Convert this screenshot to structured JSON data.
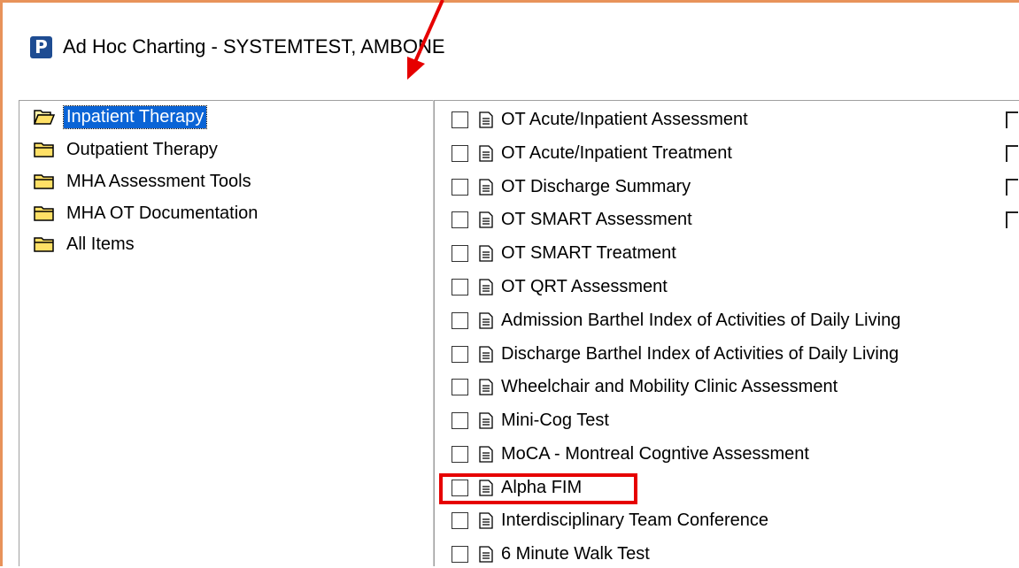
{
  "window": {
    "app_icon_letter": "P",
    "title": "Ad Hoc Charting - SYSTEMTEST, AMBONE"
  },
  "folders": [
    {
      "label": "Inpatient Therapy",
      "icon": "folder-open-icon",
      "selected": true
    },
    {
      "label": "Outpatient Therapy",
      "icon": "folder-icon",
      "selected": false
    },
    {
      "label": "MHA Assessment Tools",
      "icon": "folder-icon",
      "selected": false
    },
    {
      "label": "MHA OT Documentation",
      "icon": "folder-icon",
      "selected": false
    },
    {
      "label": "All Items",
      "icon": "folder-icon",
      "selected": false
    }
  ],
  "forms": [
    {
      "label": "OT Acute/Inpatient Assessment",
      "checked": false
    },
    {
      "label": "OT Acute/Inpatient Treatment",
      "checked": false
    },
    {
      "label": "OT Discharge Summary",
      "checked": false
    },
    {
      "label": "OT SMART Assessment",
      "checked": false
    },
    {
      "label": "OT SMART Treatment",
      "checked": false
    },
    {
      "label": "OT QRT Assessment",
      "checked": false
    },
    {
      "label": "Admission Barthel Index of Activities of Daily Living",
      "checked": false
    },
    {
      "label": "Discharge Barthel Index of Activities of Daily Living",
      "checked": false
    },
    {
      "label": "Wheelchair and Mobility Clinic Assessment",
      "checked": false
    },
    {
      "label": "Mini-Cog Test",
      "checked": false
    },
    {
      "label": "MoCA - Montreal Cogntive Assessment",
      "checked": false
    },
    {
      "label": "Alpha FIM",
      "checked": false
    },
    {
      "label": "Interdisciplinary Team Conference",
      "checked": false
    },
    {
      "label": "6 Minute Walk Test",
      "checked": false
    }
  ],
  "colors": {
    "window_border": "#e8935a",
    "selection": "#0a64d6",
    "annotation_red": "#e60000",
    "app_icon_bg": "#1e4c92"
  }
}
